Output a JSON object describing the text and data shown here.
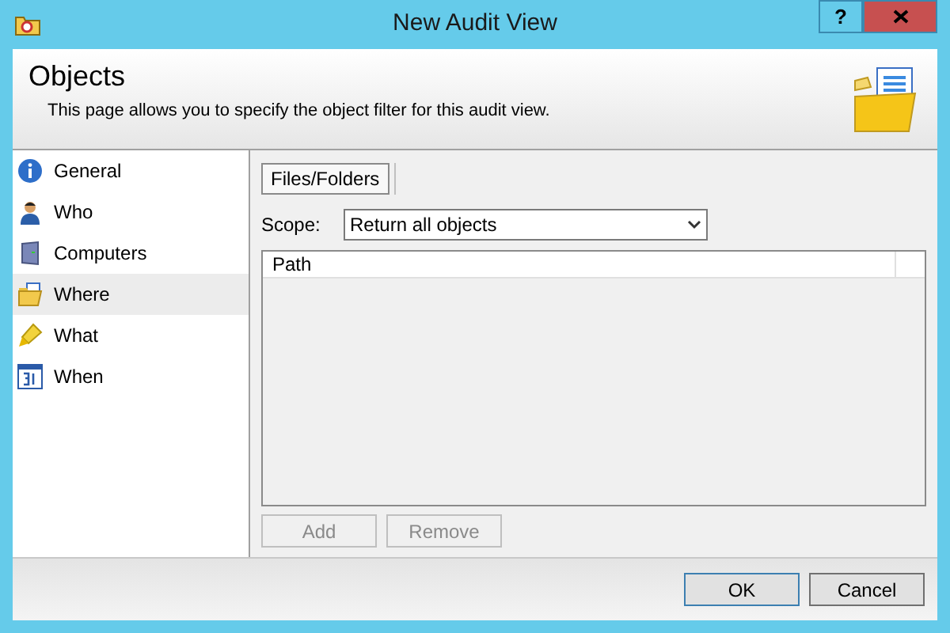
{
  "window": {
    "title": "New Audit View",
    "help_button": "?"
  },
  "header": {
    "title": "Objects",
    "description": "This page allows you to specify the object filter for this audit view."
  },
  "sidebar": {
    "items": [
      {
        "label": "General",
        "kind": "info",
        "selected": false
      },
      {
        "label": "Who",
        "kind": "user",
        "selected": false
      },
      {
        "label": "Computers",
        "kind": "computer",
        "selected": false
      },
      {
        "label": "Where",
        "kind": "folder",
        "selected": true
      },
      {
        "label": "What",
        "kind": "marker",
        "selected": false
      },
      {
        "label": "When",
        "kind": "calendar",
        "selected": false
      }
    ]
  },
  "tabs": [
    {
      "label": "Files/Folders",
      "selected": true
    }
  ],
  "scope": {
    "label": "Scope:",
    "value": "Return all objects"
  },
  "table": {
    "columns": [
      "Path"
    ]
  },
  "list_buttons": [
    {
      "label": "Add",
      "disabled": true
    },
    {
      "label": "Remove",
      "disabled": true
    }
  ],
  "footer_buttons": [
    {
      "label": "OK",
      "default": true
    },
    {
      "label": "Cancel",
      "default": false
    }
  ]
}
